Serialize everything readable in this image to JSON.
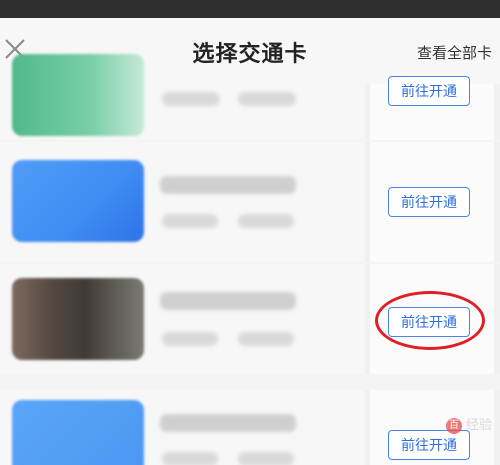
{
  "header": {
    "title": "选择交通卡",
    "view_all": "查看全部卡"
  },
  "cards": [
    {
      "thumb": "green",
      "action_label": "前往开通"
    },
    {
      "thumb": "blue",
      "action_label": "前往开通"
    },
    {
      "thumb": "photo",
      "action_label": "前往开通"
    },
    {
      "thumb": "blue",
      "action_label": "前往开通"
    }
  ],
  "watermark": {
    "text": "经验",
    "badge": "百"
  },
  "colors": {
    "accent": "#2f6ee0",
    "highlight": "#e01e26",
    "statusbar": "#2f2f2f"
  }
}
